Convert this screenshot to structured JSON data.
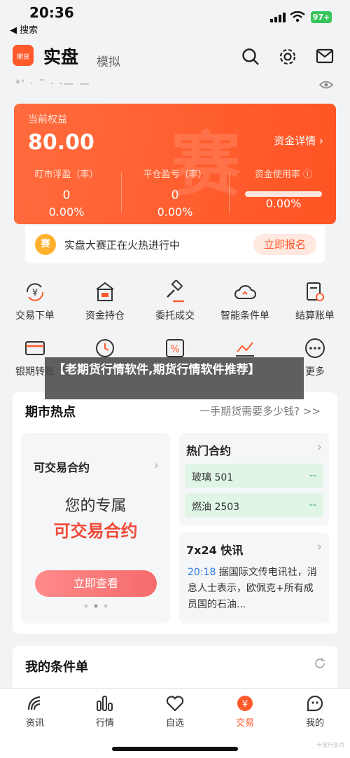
{
  "status": {
    "time": "20:36",
    "back_label": "◀ 搜索",
    "battery": "97+"
  },
  "header": {
    "title": "实盘",
    "mode": "模拟",
    "logo_text": "期货"
  },
  "account": {
    "masked_id": "*' · ˜ · ·— —"
  },
  "equity": {
    "label": "当前权益",
    "value": "80.00",
    "detail_link": "资金详情 ›",
    "watermark": "赛",
    "metrics": [
      {
        "label": "盯市浮盈（率）",
        "value": "0",
        "pct": "0.00%"
      },
      {
        "label": "平仓盈亏（率）",
        "value": "0",
        "pct": "0.00%"
      },
      {
        "label": "资金使用率 ⓘ",
        "value": "",
        "pct": "0.00%"
      }
    ]
  },
  "contest": {
    "badge": "赛",
    "text": "实盘大赛正在火热进行中",
    "button": "立即报名"
  },
  "grid": [
    {
      "label": "交易下单"
    },
    {
      "label": "资金持仓"
    },
    {
      "label": "委托成交"
    },
    {
      "label": "智能条件单"
    },
    {
      "label": "结算账单"
    },
    {
      "label": "银期转账"
    },
    {
      "label": ""
    },
    {
      "label": ""
    },
    {
      "label": ""
    },
    {
      "label": "更多"
    }
  ],
  "overlay": {
    "title": "【老期货行情软件,期货行情软件推荐】"
  },
  "hot": {
    "title": "期市热点",
    "question": "一手期货需要多少钱? >>",
    "tradable": {
      "title": "可交易合约",
      "line1": "您的专属",
      "line2": "可交易合约",
      "button": "立即查看"
    },
    "contracts": {
      "title": "热门合约",
      "rows": [
        {
          "name": "玻璃 501",
          "value": "--"
        },
        {
          "name": "燃油 2503",
          "value": "--"
        }
      ]
    },
    "news": {
      "title": "7x24 快讯",
      "time": "20:18",
      "text": " 据国际文传电讯社，消息人士表示，欧佩克+所有成员国的石油..."
    }
  },
  "conditions": {
    "title": "我的条件单"
  },
  "tabs": [
    {
      "label": "资讯"
    },
    {
      "label": "行情"
    },
    {
      "label": "自选"
    },
    {
      "label": "交易"
    },
    {
      "label": "我的"
    }
  ],
  "corner_mark": "卡宝行业点",
  "colors": {
    "accent": "#ff5a2c",
    "positive": "#3aa35a",
    "link": "#2d7be0"
  }
}
